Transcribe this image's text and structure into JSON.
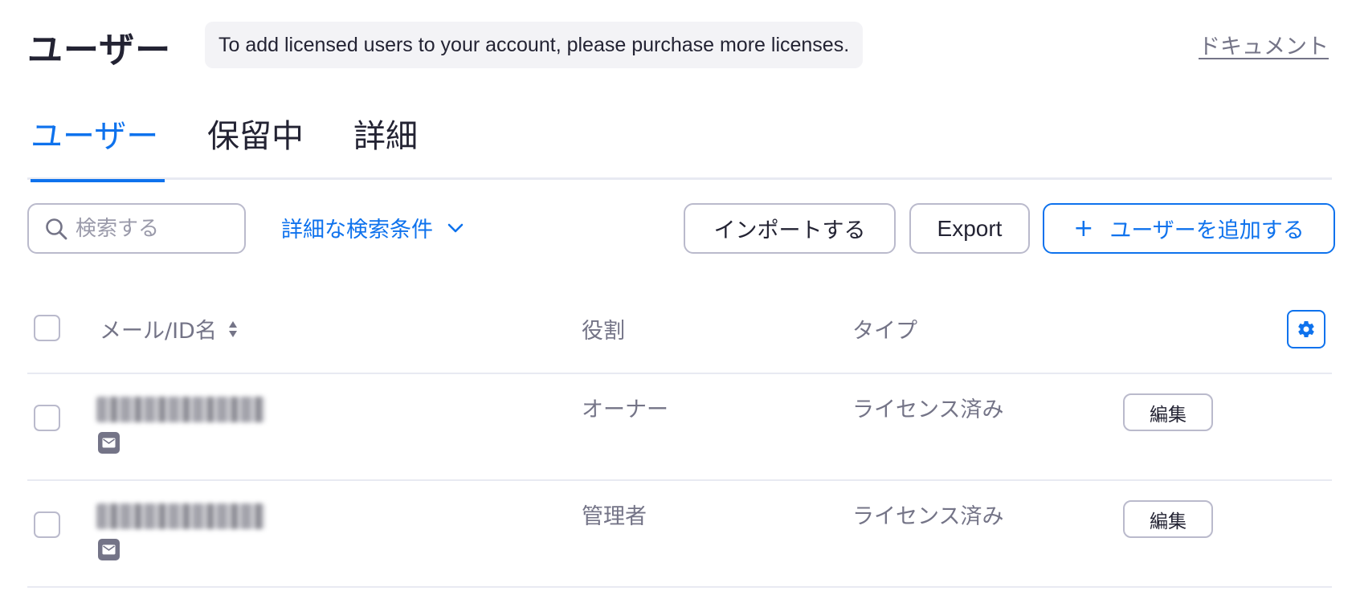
{
  "header": {
    "title": "ユーザー",
    "notice": "To add licensed users to your account, please purchase more licenses.",
    "doc_link": "ドキュメント"
  },
  "tabs": [
    {
      "label": "ユーザー",
      "active": true
    },
    {
      "label": "保留中",
      "active": false
    },
    {
      "label": "詳細",
      "active": false
    }
  ],
  "toolbar": {
    "search_placeholder": "検索する",
    "advanced_search": "詳細な検索条件",
    "import_label": "インポートする",
    "export_label": "Export",
    "add_user_label": "ユーザーを追加する",
    "add_user_icon": "plus-icon"
  },
  "table": {
    "columns": [
      "メール/ID名",
      "役割",
      "タイプ"
    ],
    "rows": [
      {
        "email": "",
        "role": "オーナー",
        "type": "ライセンス済み",
        "action": "編集"
      },
      {
        "email": "",
        "role": "管理者",
        "type": "ライセンス済み",
        "action": "編集"
      }
    ]
  },
  "colors": {
    "accent": "#0e72ed",
    "text": "#232333",
    "muted": "#747487",
    "border": "#babacc"
  }
}
